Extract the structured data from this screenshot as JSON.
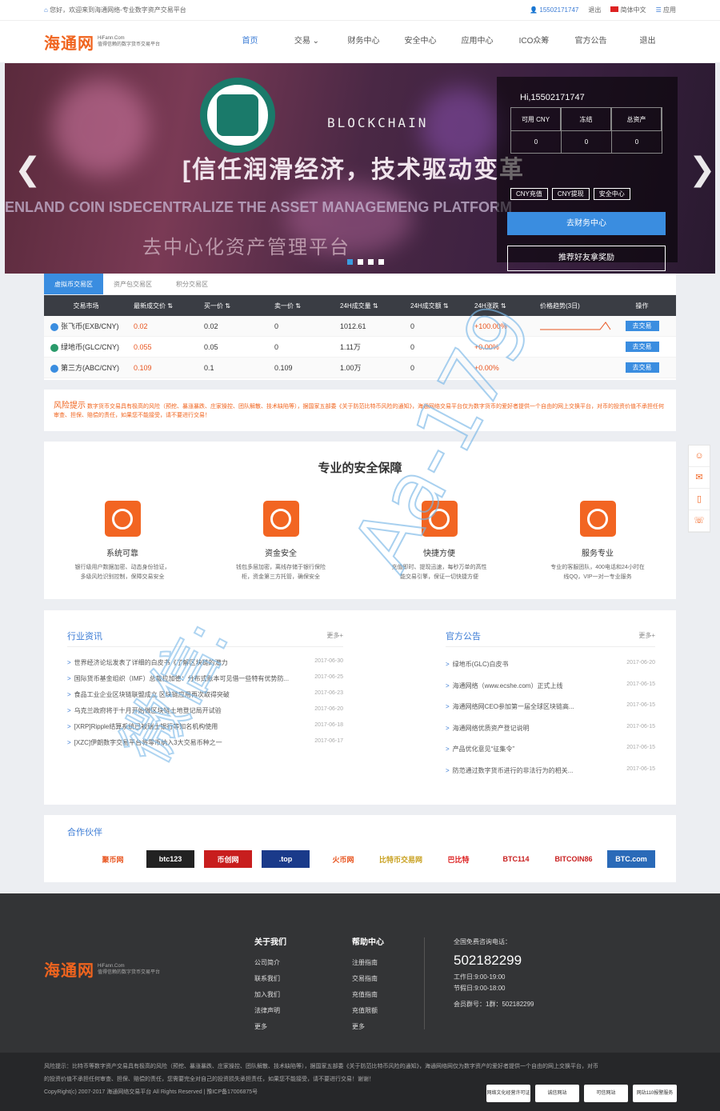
{
  "topbar": {
    "welcome": "您好，欢迎来到海通网络-专业数字资产交易平台",
    "user": "15502171747",
    "logout": "退出",
    "lang": "简体中文",
    "apps": "应用"
  },
  "logo": {
    "cn": "海通网",
    "en1": "HiFann.Com",
    "en2": "值得信赖的数字货币交易平台"
  },
  "nav": [
    "首页",
    "交易 ⌄",
    "财务中心",
    "安全中心",
    "应用中心",
    "ICO众筹",
    "官方公告",
    "退出"
  ],
  "banner": {
    "line1": "BLOCKCHAIN",
    "line2": "[信任润滑经济，技术驱动变革",
    "line3": "ENLAND COIN ISDECENTRALIZE THE ASSET MANAGEMENG PLATFORM",
    "line4": "去中心化资产管理平台"
  },
  "account": {
    "hi": "Hi,15502171747",
    "cols": [
      {
        "h": "可用 CNY",
        "v": "0"
      },
      {
        "h": "冻结",
        "v": "0"
      },
      {
        "h": "总资产",
        "v": "0"
      }
    ],
    "btns": [
      "CNY充值",
      "CNY提现",
      "安全中心"
    ],
    "go": "去财务中心",
    "reward": "推荐好友拿奖励"
  },
  "market": {
    "tabs": [
      "虚拟币交易区",
      "资产包交易区",
      "积分交易区"
    ],
    "headers": [
      "交易市场",
      "最新成交价 ⇅",
      "买一价 ⇅",
      "卖一价 ⇅",
      "24H成交量 ⇅",
      "24H成交额 ⇅",
      "24H涨跌 ⇅",
      "价格趋势(3日)",
      "操作"
    ],
    "rows": [
      {
        "name": "张飞币(EXB/CNY)",
        "price": "0.02",
        "buy": "0.02",
        "sell": "0",
        "vol": "1012.61",
        "amt": "0",
        "chg": "+100.00%",
        "btn": "去交易"
      },
      {
        "name": "绿地币(GLC/CNY)",
        "price": "0.055",
        "buy": "0.05",
        "sell": "0",
        "vol": "1.11万",
        "amt": "0",
        "chg": "+0.00%",
        "btn": "去交易"
      },
      {
        "name": "第三方(ABC/CNY)",
        "price": "0.109",
        "buy": "0.1",
        "sell": "0.109",
        "vol": "1.00万",
        "amt": "0",
        "chg": "+0.00%",
        "btn": "去交易"
      }
    ]
  },
  "risk": {
    "title": "风险提示",
    "text": "数字货币交易具有极高的风险（预挖、暴涨暴跌、庄家操控、团队解散、技术缺陷等），据国家五部委《关于防范比特币风险的通知》，海通网络交易平台仅为数字货币的爱好者提供一个自由的网上交换平台，对币的投资价值不承担任何审查、担保、赔偿的责任，如果您不能接受，请不要进行交易！"
  },
  "security": {
    "title": "专业的安全保障",
    "items": [
      {
        "t": "系统可靠",
        "d1": "银行级用户数据加密、动态身份验证，",
        "d2": "多级风险识别控制，保障交易安全"
      },
      {
        "t": "资金安全",
        "d1": "钱包多层加密，离线存储于银行保险",
        "d2": "柜，资金第三方托管，确保安全"
      },
      {
        "t": "快捷方便",
        "d1": "充值即时、提现迅速，每秒万单的高性",
        "d2": "能交易引擎，保证一切快捷方便"
      },
      {
        "t": "服务专业",
        "d1": "专业的客服团队，400电话和24小时在",
        "d2": "线QQ，VIP一对一专业服务"
      }
    ]
  },
  "news": {
    "title": "行业资讯",
    "more": "更多+",
    "items": [
      {
        "t": "世界经济论坛发表了详细的白皮书《了解区块链的潜力",
        "d": "2017-06-30"
      },
      {
        "t": "国际货币基金组织（IMF）总裁拉加德：分布式账本可见借一些特有优势防...",
        "d": "2017-06-25"
      },
      {
        "t": "食品工业企业区块链联盟成立 区块链应用再次取得突破",
        "d": "2017-06-23"
      },
      {
        "t": "乌克兰政府将于十月开始做区块链土地登记局开试验",
        "d": "2017-06-20"
      },
      {
        "t": "[XRP]Ripple结算系统已被瑞士银行等知名机构使用",
        "d": "2017-06-18"
      },
      {
        "t": "[XZC]伊朗数字交易平台将零币纳入3大交易币种之一",
        "d": "2017-06-17"
      }
    ]
  },
  "notice": {
    "title": "官方公告",
    "more": "更多+",
    "items": [
      {
        "t": "绿地币(GLC)白皮书",
        "d": "2017-06-20"
      },
      {
        "t": "海通网络（www.ecshe.com）正式上线",
        "d": "2017-06-15"
      },
      {
        "t": "海通网络网CEO参加第一届全球区块链高...",
        "d": "2017-06-15"
      },
      {
        "t": "海通网络优质资产登记说明",
        "d": "2017-06-15"
      },
      {
        "t": "产品优化意见“征集令”",
        "d": "2017-06-15"
      },
      {
        "t": "防范通过数字货币进行的非法行为的相关...",
        "d": "2017-06-15"
      }
    ]
  },
  "partners": {
    "title": "合作伙伴",
    "logos": [
      "聚币网",
      "btc123",
      "币创网",
      ".top",
      "火币网",
      "比特币交易网",
      "巴比特",
      "BTC114",
      "BITCOIN86",
      "BTC.com"
    ]
  },
  "footer": {
    "about": {
      "h": "关于我们",
      "items": [
        "公司简介",
        "联系我们",
        "加入我们",
        "法律声明",
        "更多"
      ]
    },
    "help": {
      "h": "帮助中心",
      "items": [
        "注册指南",
        "交易指南",
        "充值指南",
        "充值限额",
        "更多"
      ]
    },
    "contact": {
      "label": "全国免费咨询电话：",
      "tel": "502182299",
      "work": "工作日:9:00-19:00",
      "holiday": "节假日:9:00-18:00",
      "qq": "会员群号：1群：502182299"
    }
  },
  "bottom": {
    "risk1": "风险提示：比特币等数字资产交易具有极高的风险（预挖、暴涨暴跌、庄家操控、团队解散、技术缺陷等），据国家五部委《关于防范比特币风险的通知》，海通网络网仅为数字资产的爱好者提供一个自由的网上交换平台，对币",
    "risk2": "的投资价值不承担任何审查、担保、赔偿的责任，您需要完全对自己的投资损失承担责任，如果您不能接受，请不要进行交易！谢谢！",
    "copy": "CopyRight(c) 2007-2017 海通网络交易平台 All Rights Reserved  |  豫ICP备17006875号",
    "badges": [
      "网络文化经营许可证",
      "诚信网站",
      "可信网站",
      "网站110报警服务"
    ]
  },
  "watermark": {
    "text1": "Aa-179",
    "text2": "微信:"
  }
}
